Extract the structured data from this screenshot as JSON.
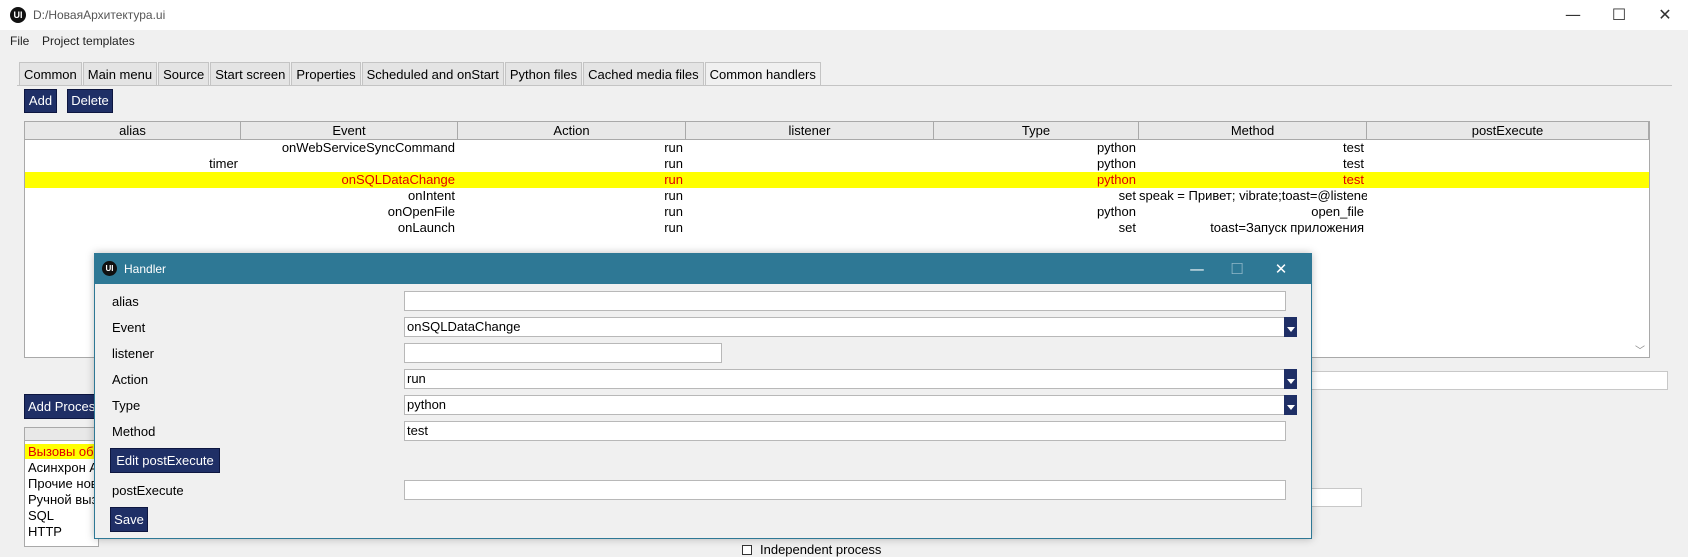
{
  "window": {
    "logo": "UI",
    "title": "D:/НоваяАрхитектура.ui",
    "controls": [
      "—",
      "☐",
      "✕"
    ]
  },
  "menu": {
    "items": [
      "File",
      "Project templates"
    ]
  },
  "tabs": [
    "Common",
    "Main menu",
    "Source",
    "Start screen",
    "Properties",
    "Scheduled and onStart",
    "Python files",
    "Cached media files",
    "Common handlers"
  ],
  "toolbar": {
    "add_label": "Add",
    "delete_label": "Delete"
  },
  "table": {
    "columns": [
      "alias",
      "Event",
      "Action",
      "listener",
      "Type",
      "Method",
      "postExecute"
    ],
    "rows": [
      [
        "",
        "onWebServiceSyncCommand",
        "run",
        "",
        "python",
        "test",
        ""
      ],
      [
        "timer",
        "",
        "run",
        "",
        "python",
        "test",
        ""
      ],
      [
        "",
        "onSQLDataChange",
        "run",
        "",
        "python",
        "test",
        ""
      ],
      [
        "",
        "onIntent",
        "run",
        "",
        "set",
        "speak = Привет; vibrate;toast=@listener",
        ""
      ],
      [
        "",
        "onOpenFile",
        "run",
        "",
        "python",
        "open_file",
        ""
      ],
      [
        "",
        "onLaunch",
        "run",
        "",
        "set",
        "toast=Запуск приложения",
        ""
      ]
    ],
    "selected_row": 2,
    "selected_colors": {
      "background": "#ffff00",
      "text": "#e00000"
    }
  },
  "lower": {
    "add_process_label": "Add Process",
    "process_list": [
      "Вызовы об",
      "Асинхрон А",
      "Прочие нов",
      "Ручной выз",
      "SQL",
      "HTTP"
    ],
    "independent_label": "Independent process"
  },
  "dialog": {
    "logo": "UI",
    "title": "Handler",
    "controls": [
      "—",
      "☐",
      "✕"
    ],
    "fields": {
      "alias_label": "alias",
      "alias_value": "",
      "event_label": "Event",
      "event_value": "onSQLDataChange",
      "listener_label": "listener",
      "listener_value": "",
      "action_label": "Action",
      "action_value": "run",
      "type_label": "Type",
      "type_value": "python",
      "method_label": "Method",
      "method_value": "test",
      "post_label": "postExecute",
      "post_value": ""
    },
    "edit_post_label": "Edit postExecute",
    "save_label": "Save"
  },
  "colors": {
    "accent_button": "#1f2f66",
    "dialog_titlebar": "#2e7895"
  }
}
